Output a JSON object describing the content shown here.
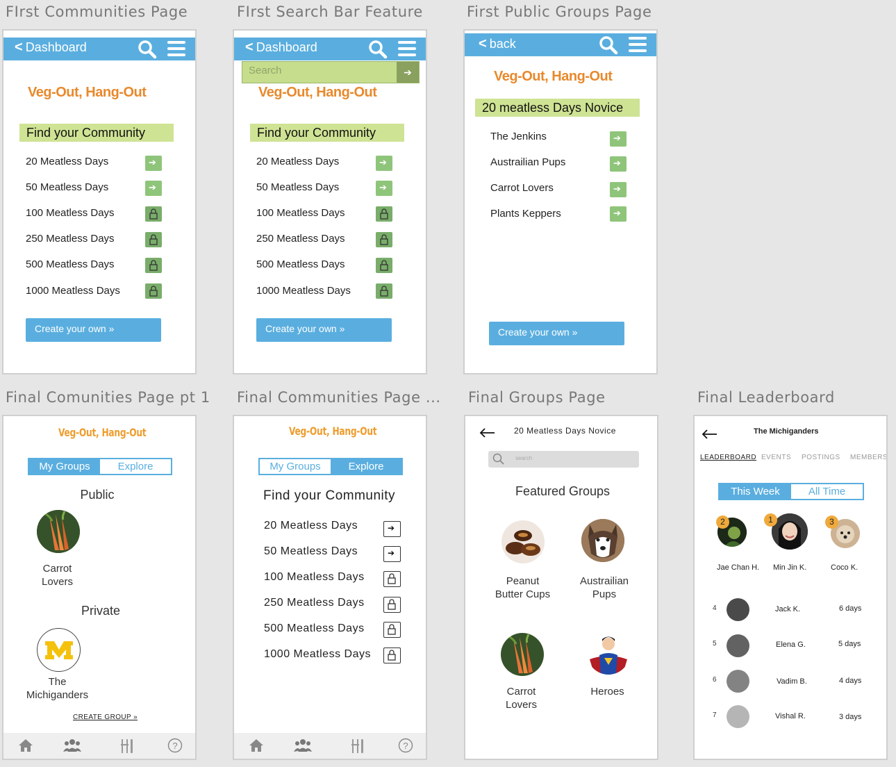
{
  "titles": {
    "f1": "FIrst Communities Page",
    "f2": "FIrst Search Bar Feature",
    "f3": "First Public Groups Page",
    "f4": "Final Comunities Page pt 1",
    "f5": "Final Communities Page ...",
    "f6": "Final Groups Page",
    "f7": "Final Leaderboard"
  },
  "old": {
    "dashboard": "Dashboard",
    "back": "back",
    "app_name": "Veg-Out, Hang-Out",
    "find": "Find your Community",
    "search_placeholder": "Search",
    "create": "Create your own »",
    "communities": [
      "20 Meatless Days",
      "50 Meatless Days",
      "100 Meatless Days",
      "250 Meatless Days",
      "500 Meatless Days",
      "1000 Meatless Days"
    ],
    "community_icons": [
      "arrow-icon",
      "arrow-icon",
      "lock-icon",
      "lock-icon",
      "lock-icon",
      "lock-icon"
    ],
    "group_title": "20 meatless Days Novice",
    "groups": [
      "The Jenkins",
      "Austrailian Pups",
      "Carrot Lovers",
      "Plants Keppers"
    ]
  },
  "final": {
    "app_name": "Veg-Out, Hang-Out",
    "tab_my": "My Groups",
    "tab_explore": "Explore",
    "public": "Public",
    "private": "Private",
    "carrot1": "Carrot",
    "carrot2": "Lovers",
    "mich1": "The",
    "mich2": "Michiganders",
    "create_group": "CREATE GROUP »",
    "find": "Find your Community",
    "communities": [
      "20 Meatless Days",
      "50 Meatless Days",
      "100 Meatless Days",
      "250 Meatless Days",
      "500 Meatless Days",
      "1000 Meatless Days"
    ],
    "groups_header": "20 Meatless Days Novice",
    "search_placeholder": "search",
    "featured": "Featured Groups",
    "peanut1": "Peanut",
    "peanut2": "Butter Cups",
    "aus1": "Austrailian",
    "aus2": "Pups",
    "heroes": "Heroes"
  },
  "leaderboard": {
    "title": "The Michiganders",
    "tabs": [
      "LEADERBOARD",
      "EVENTS",
      "POSTINGS",
      "MEMBERS"
    ],
    "this_week": "This Week",
    "all_time": "All Time",
    "podium": [
      {
        "rank": "2",
        "name": "Jae Chan H."
      },
      {
        "rank": "1",
        "name": "Min Jin K."
      },
      {
        "rank": "3",
        "name": "Coco K."
      }
    ],
    "list": [
      {
        "rank": "4",
        "name": "Jack K.",
        "days": "6 days"
      },
      {
        "rank": "5",
        "name": "Elena G.",
        "days": "5 days"
      },
      {
        "rank": "6",
        "name": "Vadim B.",
        "days": "4 days"
      },
      {
        "rank": "7",
        "name": "Vishal R.",
        "days": "3 days"
      }
    ]
  }
}
